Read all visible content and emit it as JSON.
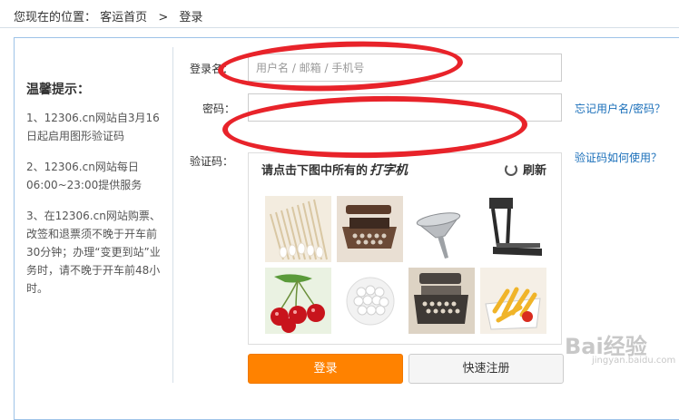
{
  "breadcrumb": {
    "prefix": "您现在的位置：",
    "home": "客运首页",
    "separator": ">",
    "current": "登录"
  },
  "tips": {
    "title": "温馨提示：",
    "items": [
      "1、12306.cn网站自3月16日起启用图形验证码",
      "2、12306.cn网站每日06:00~23:00提供服务",
      "3、在12306.cn网站购票、改签和退票须不晚于开车前30分钟；办理“变更到站”业务时，请不晚于开车前48小时。"
    ]
  },
  "form": {
    "username_label": "登录名：",
    "username_placeholder": "用户名 / 邮箱 / 手机号",
    "username_value": "",
    "password_label": "密码：",
    "password_value": "",
    "captcha_label": "验证码：",
    "forgot_link": "忘记用户名/密码？",
    "captcha_help_link": "验证码如何使用？"
  },
  "captcha": {
    "prompt": "请点击下图中所有的",
    "keyword": "打字机",
    "refresh_label": "刷新",
    "images": [
      "cotton-swabs",
      "typewriter",
      "funnel",
      "treadmill",
      "cherries",
      "cotton-swabs-bundle",
      "typewriter",
      "french-fries"
    ]
  },
  "buttons": {
    "login": "登录",
    "register": "快速注册"
  },
  "watermark": {
    "text": "Bai经验",
    "sub": "jingyan.baidu.com"
  },
  "colors": {
    "accent": "#ff8200",
    "link": "#1a6fba",
    "annotation": "#e8232a",
    "border": "#9ec3e8"
  }
}
